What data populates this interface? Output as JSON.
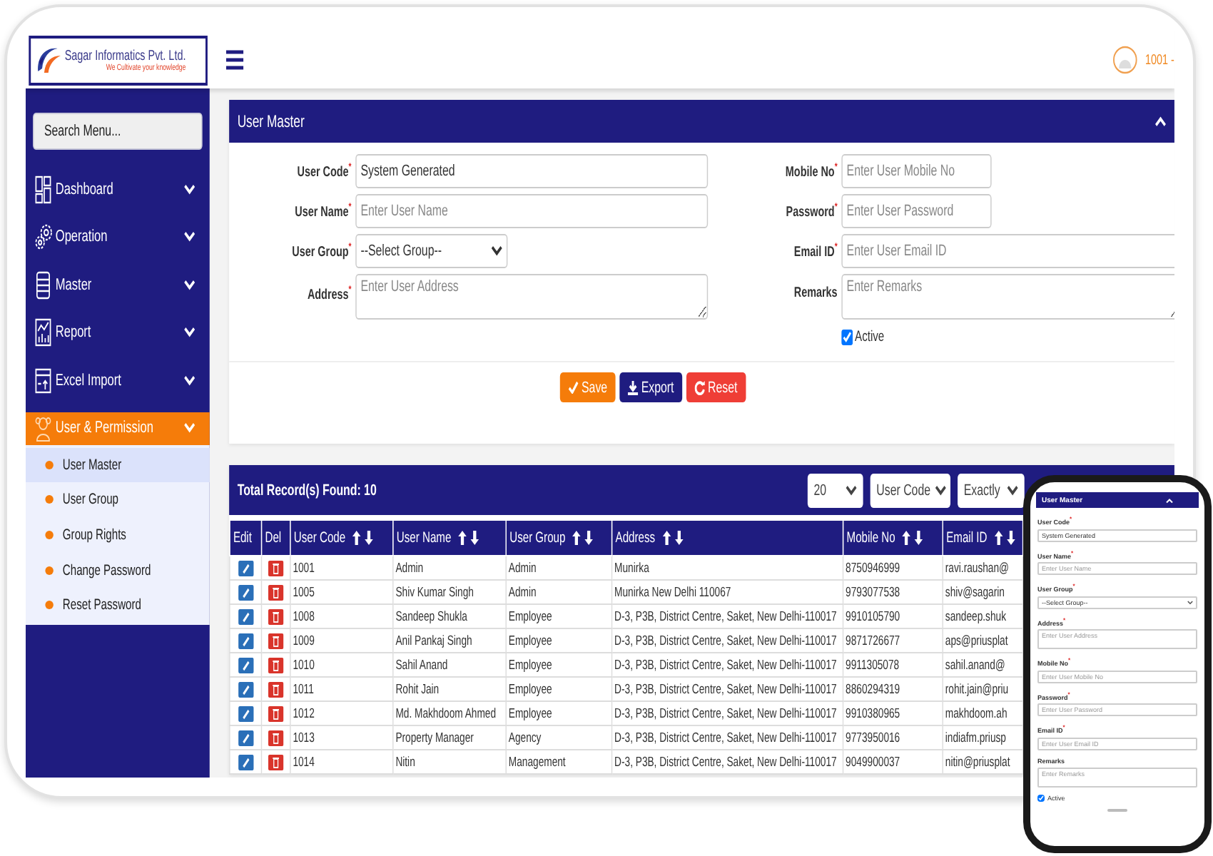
{
  "header": {
    "logo": {
      "name": "Sagar Informatics Pvt. Ltd.",
      "tagline": "We Cultivate your knowledge"
    },
    "user": "1001 -"
  },
  "sidebar": {
    "search": {
      "placeholder": "Search Menu..."
    },
    "items": [
      {
        "label": "Dashboard",
        "expanded": false
      },
      {
        "label": "Operation",
        "expanded": false
      },
      {
        "label": "Master",
        "expanded": false
      },
      {
        "label": "Report",
        "expanded": false
      },
      {
        "label": "Excel Import",
        "expanded": false
      },
      {
        "label": "User & Permission",
        "expanded": true,
        "children": [
          {
            "label": "User Master",
            "selected": true
          },
          {
            "label": "User Group",
            "selected": false
          },
          {
            "label": "Group Rights",
            "selected": false
          },
          {
            "label": "Change Password",
            "selected": false
          },
          {
            "label": "Reset Password",
            "selected": false
          }
        ]
      }
    ]
  },
  "form": {
    "title": "User Master",
    "rows": [
      {
        "left": {
          "kind": "text",
          "label": "User Code$^{*}$",
          "value": "System Generated"
        },
        "right": {
          "kind": "short",
          "label": "Mobile No$^{*}$",
          "placeholder": "Enter User Mobile No"
        }
      },
      {
        "left": {
          "kind": "text",
          "label": "User Name$^{*}$",
          "placeholder": "Enter User Name"
        },
        "right": {
          "kind": "short",
          "label": "Password$^{*}$",
          "placeholder": "Enter User Password"
        }
      },
      {
        "left": {
          "kind": "select",
          "label": "User Group$^{*}$",
          "value": "--Select Group--"
        },
        "right": {
          "kind": "text",
          "label": "Email ID$^{*}$",
          "placeholder": "Enter User Email ID"
        }
      },
      {
        "left": {
          "kind": "textarea",
          "label": "Address$^{*}$",
          "placeholder": "Enter User Address"
        },
        "right": {
          "kind": "textarea",
          "label": "Remarks",
          "placeholder": "Enter Remarks"
        }
      }
    ],
    "active": {
      "label": "Active",
      "checked": true
    },
    "buttons": [
      {
        "kind": "save",
        "label": "Save"
      },
      {
        "kind": "export",
        "label": "Export"
      },
      {
        "kind": "reset",
        "label": "Reset"
      }
    ]
  },
  "table": {
    "title": "Total Record(s) Found: 10",
    "page_size": "20",
    "search_column": "User Code",
    "match": "Exactly",
    "columns": [
      {
        "label": "Edit",
        "sortable": false
      },
      {
        "label": "Del",
        "sortable": false
      },
      {
        "label": "User Code",
        "sortable": true
      },
      {
        "label": "User Name",
        "sortable": true
      },
      {
        "label": "User Group",
        "sortable": true
      },
      {
        "label": "Address",
        "sortable": true
      },
      {
        "label": "Mobile No",
        "sortable": true
      },
      {
        "label": "Email ID",
        "sortable": true
      }
    ],
    "rows": [
      [
        "",
        "",
        "1001",
        "Admin",
        "Admin",
        "Munirka",
        "8750946999",
        "ravi.raushan@"
      ],
      [
        "",
        "",
        "1005",
        "Shiv Kumar Singh",
        "Admin",
        "Munirka New Delhi 110067",
        "9793077538",
        "shiv@sagarin"
      ],
      [
        "",
        "",
        "1008",
        "Sandeep Shukla",
        "Employee",
        "D-3, P3B, District Centre, Saket, New Delhi-110017",
        "9910105790",
        "sandeep.shuk"
      ],
      [
        "",
        "",
        "1009",
        "Anil Pankaj Singh",
        "Employee",
        "D-3, P3B, District Centre, Saket, New Delhi-110017",
        "9871726677",
        "aps@priusplat"
      ],
      [
        "",
        "",
        "1010",
        "Sahil Anand",
        "Employee",
        "D-3, P3B, District Centre, Saket, New Delhi-110017",
        "9911305078",
        "sahil.anand@"
      ],
      [
        "",
        "",
        "1011",
        "Rohit Jain",
        "Employee",
        "D-3, P3B, District Centre, Saket, New Delhi-110017",
        "8860294319",
        "rohit.jain@priu"
      ],
      [
        "",
        "",
        "1012",
        "Md. Makhdoom Ahmed",
        "Employee",
        "D-3, P3B, District Centre, Saket, New Delhi-110017",
        "9910380965",
        "makhdoom.ah"
      ],
      [
        "",
        "",
        "1013",
        "Property Manager",
        "Agency",
        "D-3, P3B, District Centre, Saket, New Delhi-110017",
        "9773950016",
        "indiafm.priusp"
      ],
      [
        "",
        "",
        "1014",
        "Nitin",
        "Management",
        "D-3, P3B, District Centre, Saket, New Delhi-110017",
        "9049900037",
        "nitin@priusplat"
      ]
    ]
  },
  "phone": {
    "title": "User Master",
    "fields": [
      {
        "kind": "text",
        "label": "User Code$^{*}$",
        "value": "System Generated"
      },
      {
        "kind": "text",
        "label": "User Name$^{*}$",
        "placeholder": "Enter User Name"
      },
      {
        "kind": "select",
        "label": "User Group$^{*}$",
        "value": "--Select Group--"
      },
      {
        "kind": "textarea",
        "label": "Address$^{*}$",
        "placeholder": "Enter User Address"
      },
      {
        "kind": "text",
        "label": "Mobile No$^{*}$",
        "placeholder": "Enter User Mobile No"
      },
      {
        "kind": "text",
        "label": "Password$^{*}$",
        "placeholder": "Enter User Password"
      },
      {
        "kind": "text",
        "label": "Email ID$^{*}$",
        "placeholder": "Enter User Email ID"
      },
      {
        "kind": "textarea",
        "label": "Remarks",
        "placeholder": "Enter Remarks"
      }
    ],
    "active": {
      "label": "Active",
      "checked": true
    }
  }
}
